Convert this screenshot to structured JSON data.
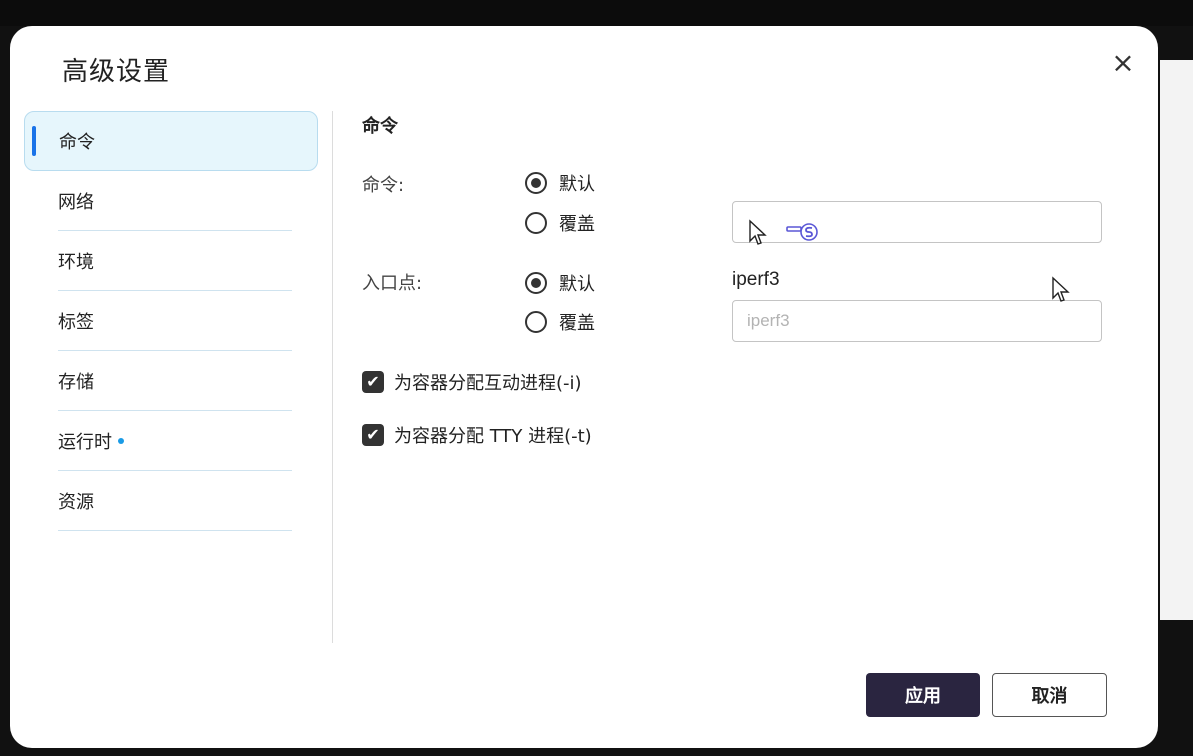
{
  "dialog": {
    "title": "高级设置",
    "close_glyph": "×"
  },
  "sidebar": {
    "items": [
      {
        "label": "命令",
        "active": true
      },
      {
        "label": "网络"
      },
      {
        "label": "环境"
      },
      {
        "label": "标签"
      },
      {
        "label": "存储"
      },
      {
        "label": "运行时",
        "badge": "dot"
      },
      {
        "label": "资源"
      }
    ]
  },
  "main": {
    "section_title": "命令",
    "command": {
      "label": "命令:",
      "option_default": "默认",
      "option_override": "覆盖",
      "selected": "默认",
      "input_value": "",
      "input_placeholder": ""
    },
    "entrypoint": {
      "label": "入口点:",
      "option_default": "默认",
      "option_override": "覆盖",
      "selected": "默认",
      "current_value": "iperf3",
      "input_placeholder": "iperf3"
    },
    "interactive_checkbox": {
      "label": "为容器分配互动进程(-i)",
      "checked": true
    },
    "tty_checkbox": {
      "label": "为容器分配 TTY 进程(-t)",
      "checked": true
    }
  },
  "footer": {
    "apply_label": "应用",
    "cancel_label": "取消"
  },
  "colors": {
    "accent": "#1a73e8",
    "apply_bg": "#2a2540",
    "active_nav_bg": "#e6f6fc"
  },
  "icons": [
    "close-icon",
    "radio-selected-icon",
    "radio-unselected-icon",
    "checkbox-checked-icon",
    "mouse-pointer-icon"
  ]
}
